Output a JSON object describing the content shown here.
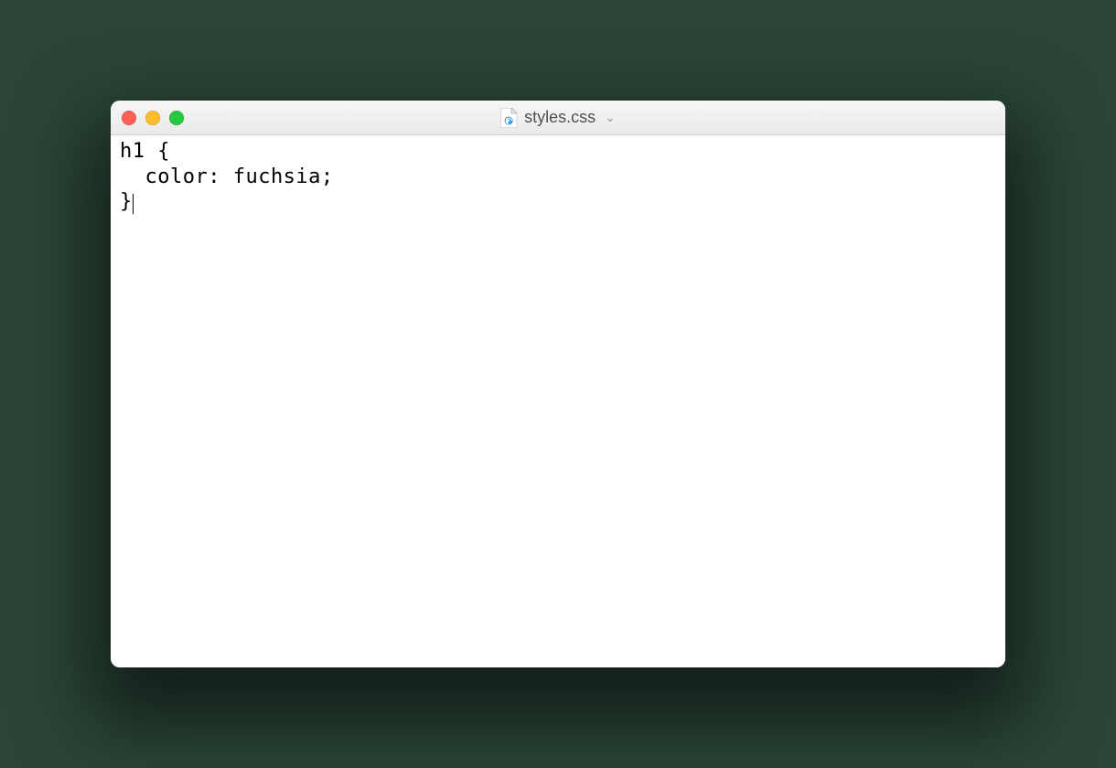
{
  "window": {
    "filename": "styles.css"
  },
  "editor": {
    "line1": "h1 {",
    "line2": "  color: fuchsia;",
    "line3": "}"
  }
}
